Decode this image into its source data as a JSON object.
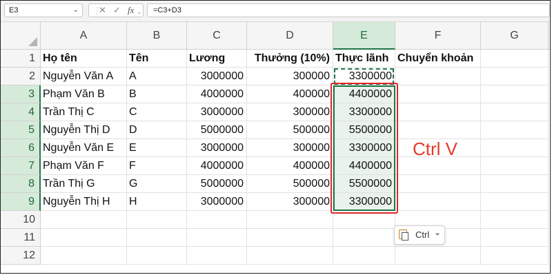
{
  "formula_bar": {
    "name_box": "E3",
    "cancel_icon": "close-icon",
    "enter_icon": "check-icon",
    "fx_label": "fx",
    "formula": "=C3+D3"
  },
  "columns": [
    "A",
    "B",
    "C",
    "D",
    "E",
    "F",
    "G"
  ],
  "rows": [
    "1",
    "2",
    "3",
    "4",
    "5",
    "6",
    "7",
    "8",
    "9",
    "10",
    "11",
    "12"
  ],
  "headers": [
    "Họ tên",
    "Tên",
    "Lương",
    "Thưởng (10%)",
    "Thực lãnh",
    "Chuyển khoản"
  ],
  "data": [
    [
      "Nguyễn Văn A",
      "A",
      "3000000",
      "300000",
      "3300000"
    ],
    [
      "Phạm Văn B",
      "B",
      "4000000",
      "400000",
      "4400000"
    ],
    [
      "Trần Thị C",
      "C",
      "3000000",
      "300000",
      "3300000"
    ],
    [
      "Nguyễn Thị D",
      "D",
      "5000000",
      "500000",
      "5500000"
    ],
    [
      "Nguyễn Văn E",
      "E",
      "3000000",
      "300000",
      "3300000"
    ],
    [
      "Phạm Văn F",
      "F",
      "4000000",
      "400000",
      "4400000"
    ],
    [
      "Trần Thị G",
      "G",
      "5000000",
      "500000",
      "5500000"
    ],
    [
      "Nguyễn Thị H",
      "H",
      "3000000",
      "300000",
      "3300000"
    ]
  ],
  "annotation": {
    "text": "Ctrl V",
    "color": "#e23a2a"
  },
  "paste_options": {
    "label": "Ctrl",
    "icon": "clipboard-icon",
    "chevron": "chevron-down-icon"
  },
  "colors": {
    "accent_green": "#217346",
    "selection_fill": "#e9f3ec",
    "highlight_red": "#e0262a"
  }
}
